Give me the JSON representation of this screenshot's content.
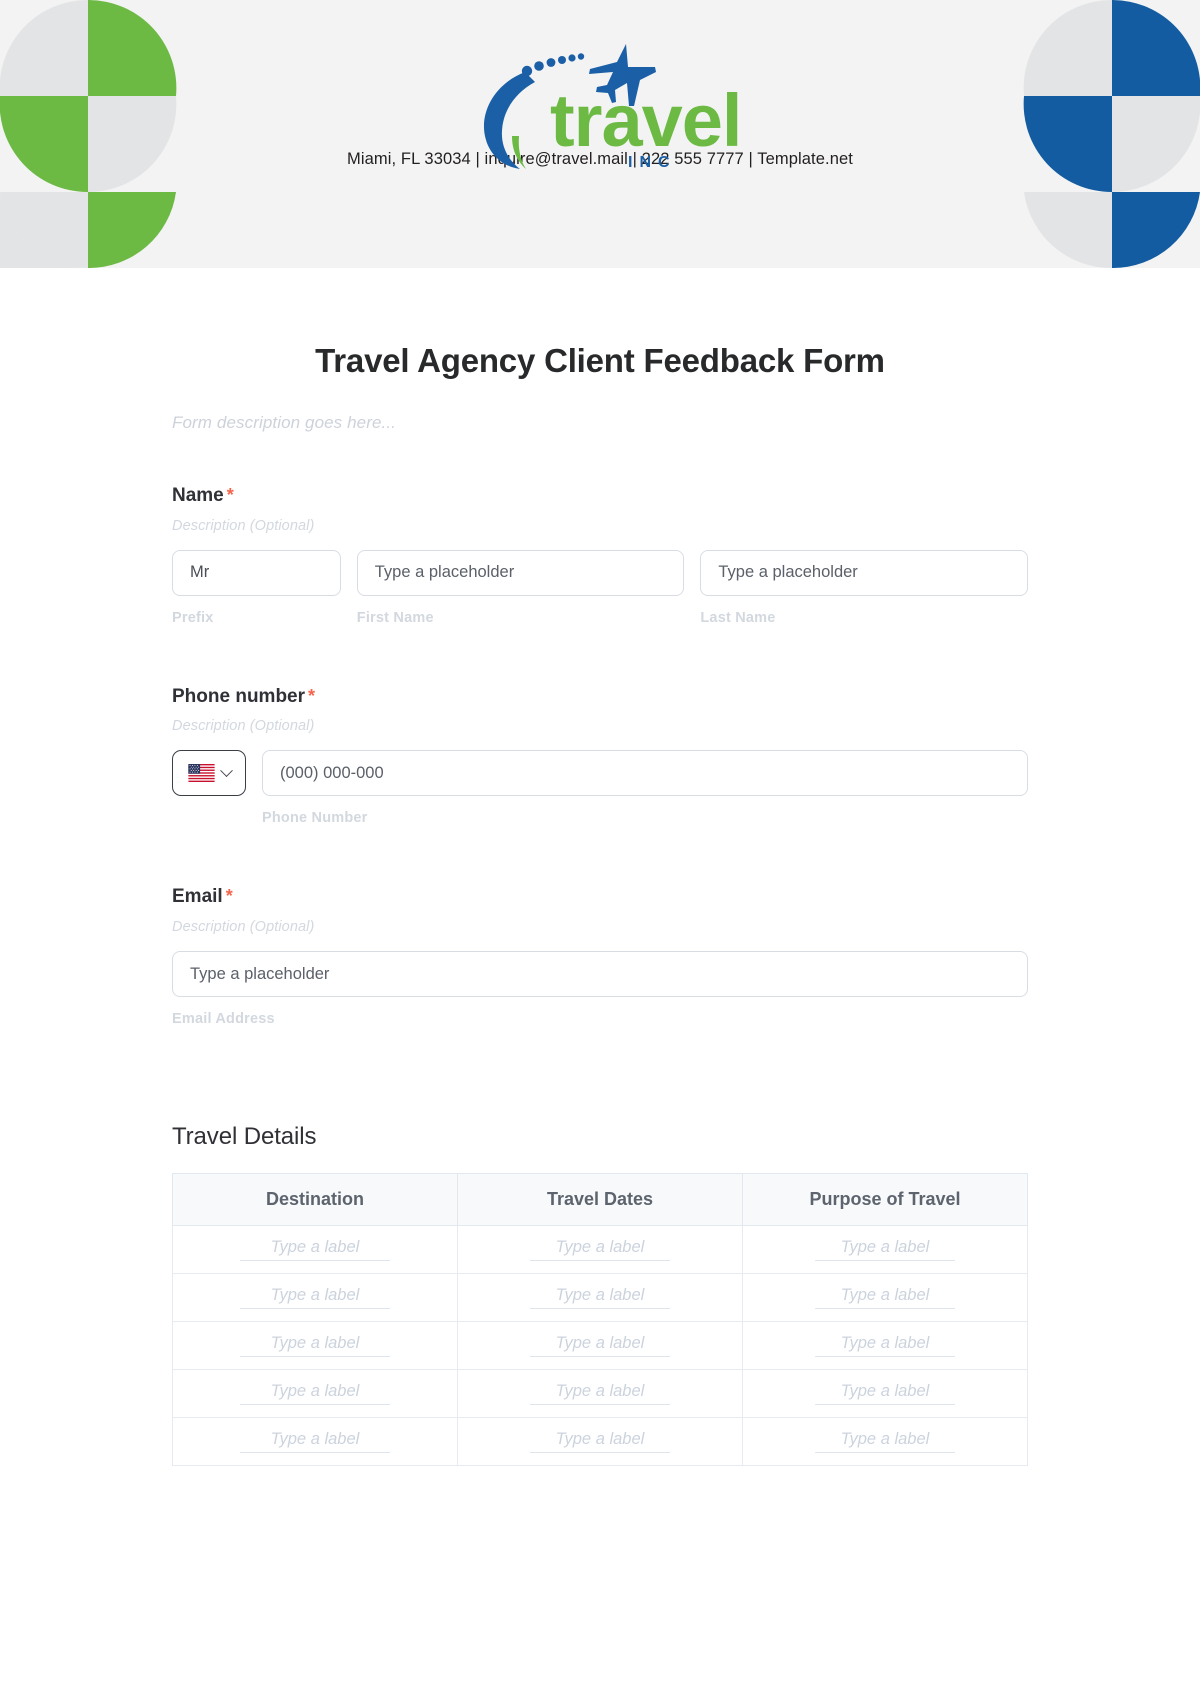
{
  "brand": {
    "logo_word": "travel",
    "logo_sub": "I N C",
    "logo_green": "#6cb944",
    "logo_blue": "#1b5fa6",
    "header_bg": "#f2f3f2",
    "deco_gray": "#e3e4e6"
  },
  "header": {
    "contact_line": "Miami, FL 33034 | inquire@travel.mail | 222 555 7777 | Template.net"
  },
  "form": {
    "title": "Travel Agency Client Feedback Form",
    "description": "Form description goes here...",
    "required_marker": "*"
  },
  "fields": [
    {
      "label": "Name",
      "required": true,
      "hint": "Description (Optional)",
      "inputs": [
        {
          "value": "Mr",
          "placeholder": "Mr",
          "sub_label": "Prefix"
        },
        {
          "value": "Type a placeholder",
          "placeholder": "Type a placeholder",
          "sub_label": "First Name"
        },
        {
          "value": "Type a placeholder",
          "placeholder": "Type a placeholder",
          "sub_label": "Last Name"
        }
      ]
    },
    {
      "label": "Phone number",
      "required": true,
      "hint": "Description (Optional)",
      "country_flag": "us-flag",
      "input": {
        "value": "(000) 000-000",
        "placeholder": "(000) 000-000",
        "sub_label": "Phone Number"
      }
    },
    {
      "label": "Email",
      "required": true,
      "hint": "Description (Optional)",
      "input": {
        "value": "Type a placeholder",
        "placeholder": "Type a placeholder",
        "sub_label": "Email Address"
      }
    }
  ],
  "travel_details": {
    "heading": "Travel Details",
    "columns": [
      "Destination",
      "Travel Dates",
      "Purpose of Travel"
    ],
    "rows": [
      [
        "Type a label",
        "Type a label",
        "Type a label"
      ],
      [
        "Type a label",
        "Type a label",
        "Type a label"
      ],
      [
        "Type a label",
        "Type a label",
        "Type a label"
      ],
      [
        "Type a label",
        "Type a label",
        "Type a label"
      ],
      [
        "Type a label",
        "Type a label",
        "Type a label"
      ]
    ]
  }
}
